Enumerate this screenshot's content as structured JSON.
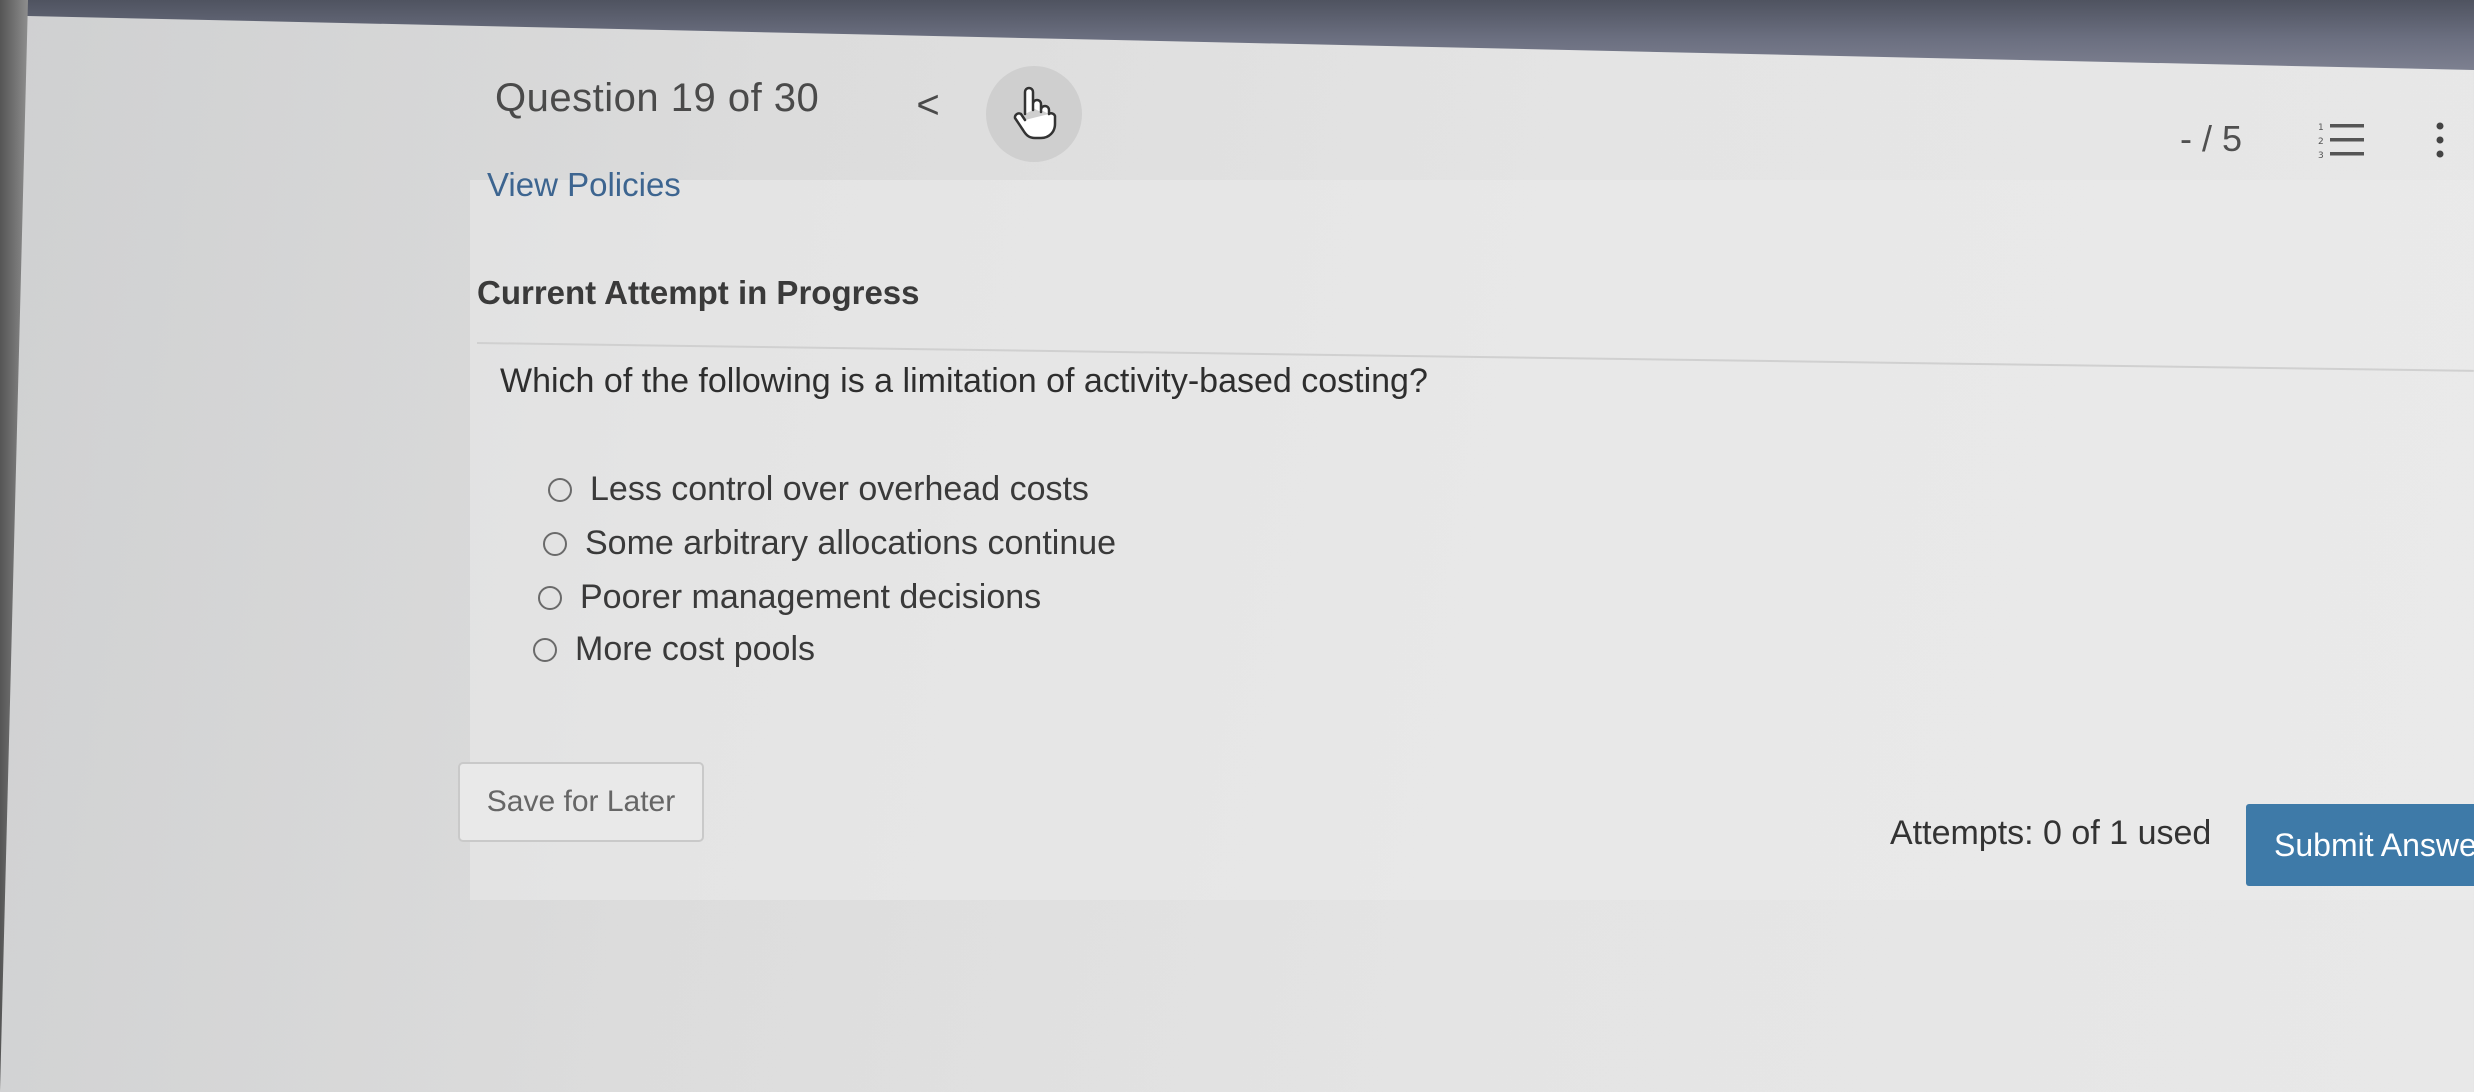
{
  "header": {
    "question_counter": "Question 19 of 30",
    "prev_symbol": "<",
    "view_policies": "View Policies",
    "score": "- / 5"
  },
  "attempt": {
    "heading": "Current Attempt in Progress"
  },
  "question": {
    "text": "Which of the following is a limitation of activity-based costing?",
    "options": [
      {
        "label": "Less control over overhead costs"
      },
      {
        "label": "Some arbitrary allocations continue"
      },
      {
        "label": "Poorer management decisions"
      },
      {
        "label": "More cost pools"
      }
    ]
  },
  "footer": {
    "save_label": "Save for Later",
    "attempts_text": "Attempts: 0 of 1 used",
    "submit_label": "Submit Answer"
  },
  "icons": {
    "next": "hand-pointer-icon",
    "list": "numbered-list-icon",
    "menu": "kebab-menu-icon"
  },
  "colors": {
    "link": "#3d6590",
    "submit_bg": "#3e7aa8"
  }
}
